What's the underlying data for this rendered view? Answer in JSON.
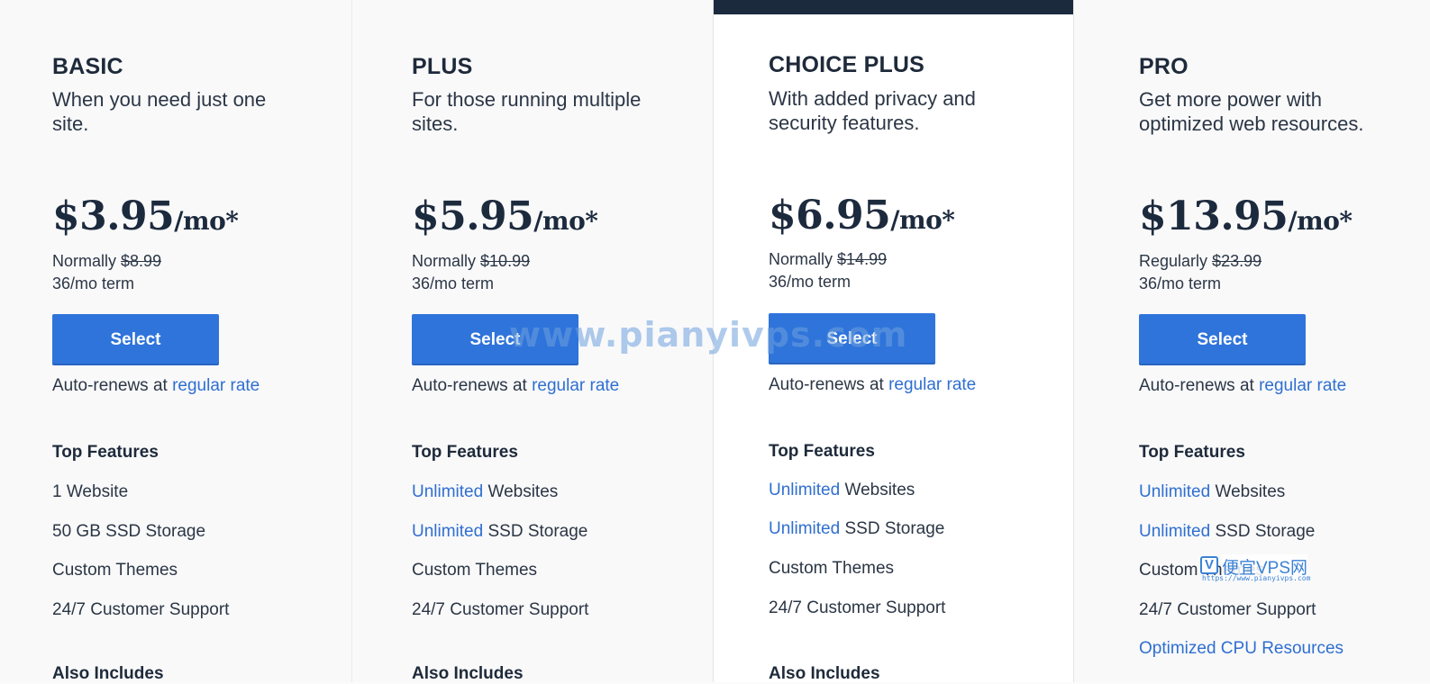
{
  "plans": [
    {
      "name": "BASIC",
      "description": "When you need just one site.",
      "price": "$3.95",
      "price_unit": "/mo*",
      "normally_label": "Normally",
      "normal_price": "$8.99",
      "term": "36/mo term",
      "select_label": "Select",
      "autorenew_text": "Auto-renews at ",
      "autorenew_link": "regular rate",
      "features_title": "Top Features",
      "features": [
        {
          "highlight": "",
          "text": "1 Website"
        },
        {
          "highlight": "",
          "text": "50 GB SSD Storage"
        },
        {
          "highlight": "",
          "text": "Custom Themes"
        },
        {
          "highlight": "",
          "text": "24/7 Customer Support"
        }
      ],
      "also_includes": "Also Includes"
    },
    {
      "name": "PLUS",
      "description": "For those running multiple sites.",
      "price": "$5.95",
      "price_unit": "/mo*",
      "normally_label": "Normally",
      "normal_price": "$10.99",
      "term": "36/mo term",
      "select_label": "Select",
      "autorenew_text": "Auto-renews at ",
      "autorenew_link": "regular rate",
      "features_title": "Top Features",
      "features": [
        {
          "highlight": "Unlimited",
          "text": " Websites"
        },
        {
          "highlight": "Unlimited",
          "text": " SSD Storage"
        },
        {
          "highlight": "",
          "text": "Custom Themes"
        },
        {
          "highlight": "",
          "text": "24/7 Customer Support"
        }
      ],
      "also_includes": "Also Includes"
    },
    {
      "name": "CHOICE PLUS",
      "description": "With added privacy and security features.",
      "price": "$6.95",
      "price_unit": "/mo*",
      "normally_label": "Normally",
      "normal_price": "$14.99",
      "term": "36/mo term",
      "select_label": "Select",
      "autorenew_text": "Auto-renews at ",
      "autorenew_link": "regular rate",
      "features_title": "Top Features",
      "features": [
        {
          "highlight": "Unlimited",
          "text": " Websites"
        },
        {
          "highlight": "Unlimited",
          "text": " SSD Storage"
        },
        {
          "highlight": "",
          "text": "Custom Themes"
        },
        {
          "highlight": "",
          "text": "24/7 Customer Support"
        }
      ],
      "also_includes": "Also Includes"
    },
    {
      "name": "PRO",
      "description": "Get more power with optimized web resources.",
      "price": "$13.95",
      "price_unit": "/mo*",
      "normally_label": "Regularly",
      "normal_price": "$23.99",
      "term": "36/mo term",
      "select_label": "Select",
      "autorenew_text": "Auto-renews at ",
      "autorenew_link": "regular rate",
      "features_title": "Top Features",
      "features": [
        {
          "highlight": "Unlimited",
          "text": " Websites"
        },
        {
          "highlight": "Unlimited",
          "text": " SSD Storage"
        },
        {
          "highlight": "",
          "text": "Custom Themes"
        },
        {
          "highlight": "",
          "text": "24/7 Customer Support"
        },
        {
          "highlight": "Optimized CPU Resources",
          "text": ""
        }
      ],
      "also_includes": ""
    }
  ],
  "watermark": {
    "text": "www.pianyivps.com",
    "badge_letter": "V",
    "badge_text": "便宜VPS网",
    "badge_url": "https://www.pianyivps.com"
  },
  "colors": {
    "button": "#2f74db",
    "link": "#2f6fd0",
    "featured_bar": "#1c2a3d",
    "heading": "#1e2a3a"
  }
}
